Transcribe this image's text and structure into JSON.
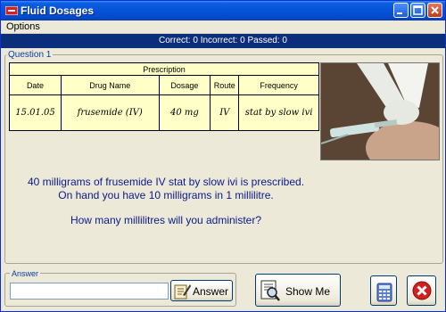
{
  "window": {
    "title": "Fluid Dosages",
    "accent": "#0553d8",
    "close_color": "#c0391c"
  },
  "menu": {
    "items": [
      "Options"
    ]
  },
  "status": {
    "text": "Correct: 0  Incorrect: 0   Passed: 0"
  },
  "question": {
    "legend": "Question 1",
    "prescription": {
      "title": "Prescription",
      "headers": [
        "Date",
        "Drug Name",
        "Dosage",
        "Route",
        "Frequency"
      ],
      "row": [
        "15.01.05",
        "frusemide (IV)",
        "40 mg",
        "IV",
        "stat by slow ivi"
      ]
    },
    "photo_icon": "injection-photo",
    "text_line1": "40 milligrams of frusemide IV stat by slow ivi is prescribed.",
    "text_line2": "On hand you have 10 milligrams in 1 millilitre.",
    "ask": "How many millilitres will you administer?"
  },
  "answer": {
    "legend": "Answer",
    "value": "",
    "button_label": "Answer",
    "button_icon": "hand-writing-icon"
  },
  "show_me": {
    "label": "Show Me",
    "icon": "magnifier-document-icon"
  },
  "calculator": {
    "icon": "calculator-icon"
  },
  "exit": {
    "icon": "close-icon",
    "color": "#d02020"
  }
}
